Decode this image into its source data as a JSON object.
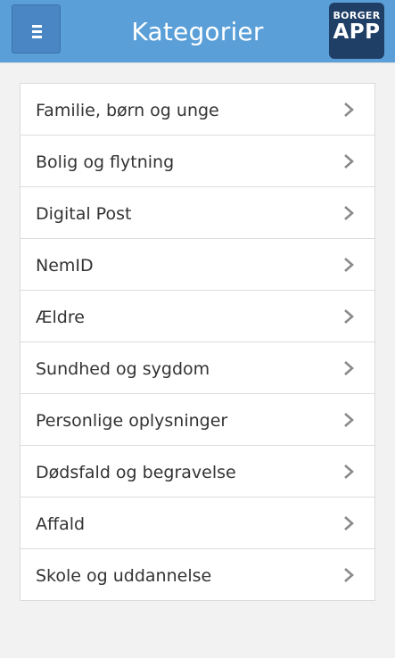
{
  "header": {
    "title": "Kategorier",
    "logo_top": "BORGER",
    "logo_bottom": "APP"
  },
  "colors": {
    "header_bg": "#5a9fd8",
    "logo_bg": "#1f3f66"
  },
  "categories": [
    {
      "label": "Familie, børn og unge"
    },
    {
      "label": "Bolig og flytning"
    },
    {
      "label": "Digital Post"
    },
    {
      "label": "NemID"
    },
    {
      "label": "Ældre"
    },
    {
      "label": "Sundhed og sygdom"
    },
    {
      "label": "Personlige oplysninger"
    },
    {
      "label": "Dødsfald og begravelse"
    },
    {
      "label": "Affald"
    },
    {
      "label": "Skole og uddannelse"
    }
  ]
}
